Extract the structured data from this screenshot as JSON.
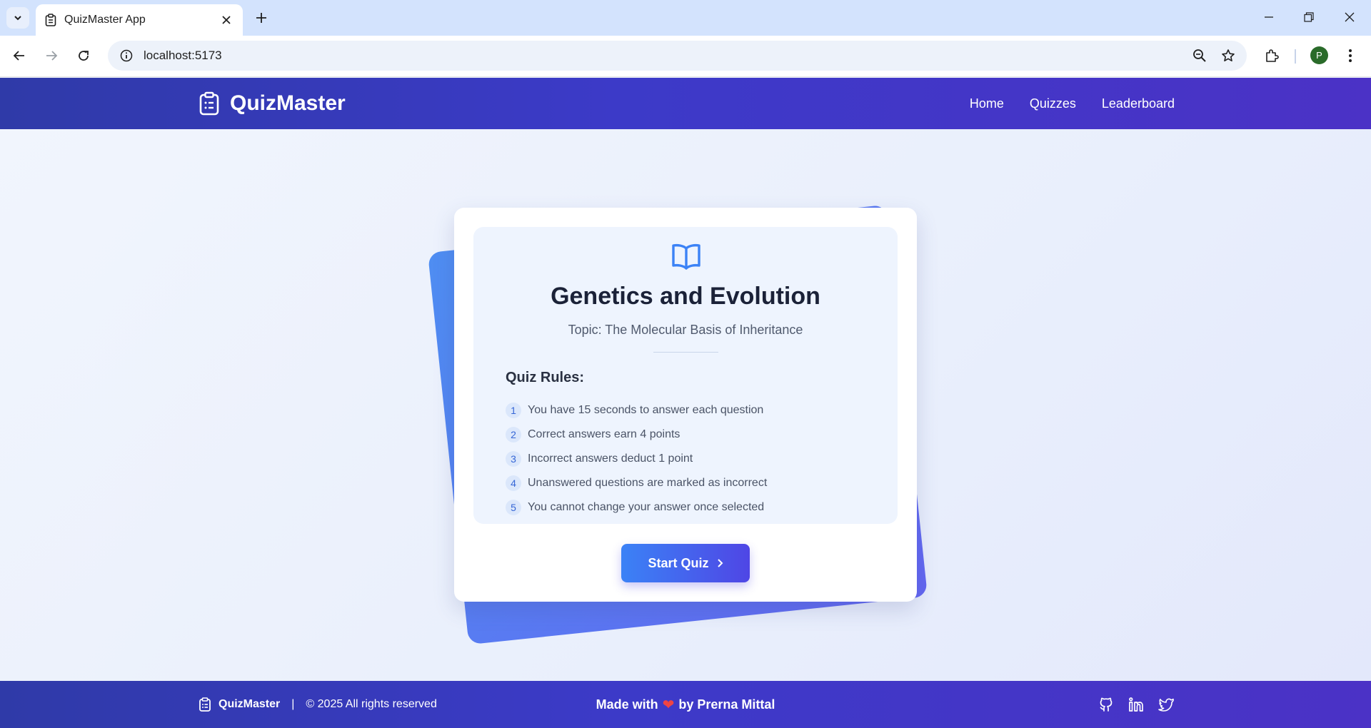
{
  "browser": {
    "tab_title": "QuizMaster App",
    "url": "localhost:5173",
    "profile_initial": "P"
  },
  "header": {
    "brand": "QuizMaster",
    "nav": [
      "Home",
      "Quizzes",
      "Leaderboard"
    ]
  },
  "quiz": {
    "title": "Genetics and Evolution",
    "topic": "Topic: The Molecular Basis of Inheritance",
    "rules_title": "Quiz Rules:",
    "rules": [
      {
        "num": "1",
        "text": "You have 15 seconds to answer each question"
      },
      {
        "num": "2",
        "text": "Correct answers earn 4 points"
      },
      {
        "num": "3",
        "text": "Incorrect answers deduct 1 point"
      },
      {
        "num": "4",
        "text": "Unanswered questions are marked as incorrect"
      },
      {
        "num": "5",
        "text": "You cannot change your answer once selected"
      }
    ],
    "start_label": "Start Quiz"
  },
  "footer": {
    "brand": "QuizMaster",
    "separator": "|",
    "copyright": "© 2025 All rights reserved",
    "made_with": "Made with",
    "heart": "❤",
    "by": "by Prerna Mittal",
    "social": [
      "github-icon",
      "linkedin-icon",
      "twitter-icon"
    ]
  },
  "colors": {
    "header_gradient_start": "#2f3aa8",
    "header_gradient_end": "#4b32c6",
    "accent_blue": "#3b82f6",
    "accent_indigo": "#4f46e5",
    "heart": "#ef4444"
  }
}
